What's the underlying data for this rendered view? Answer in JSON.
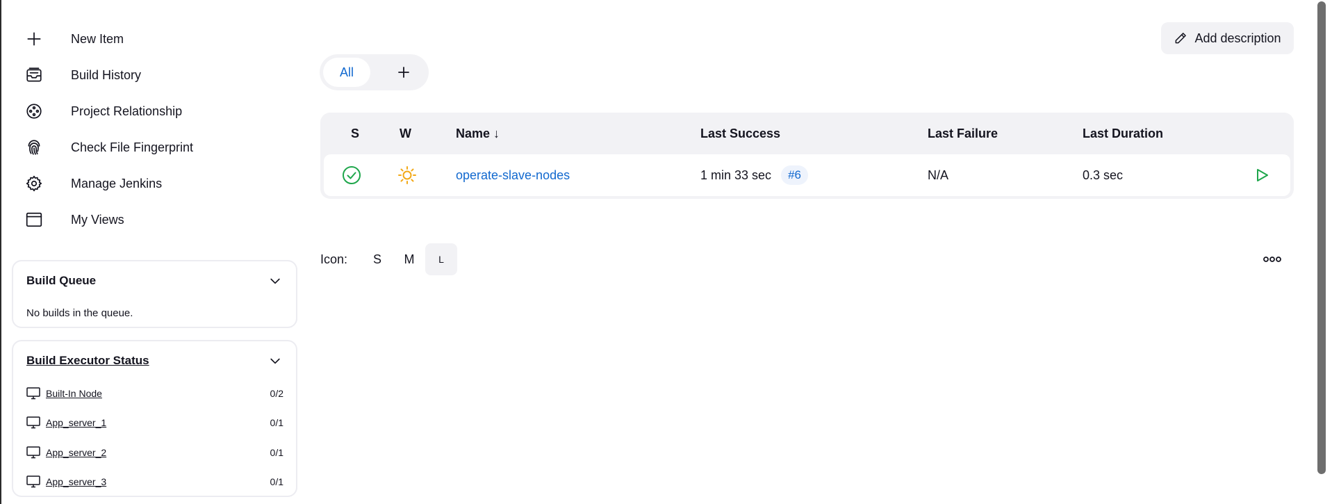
{
  "sidebar": {
    "items": [
      {
        "label": "New Item",
        "icon": "plus-icon"
      },
      {
        "label": "Build History",
        "icon": "inbox-icon"
      },
      {
        "label": "Project Relationship",
        "icon": "relationship-icon"
      },
      {
        "label": "Check File Fingerprint",
        "icon": "fingerprint-icon"
      },
      {
        "label": "Manage Jenkins",
        "icon": "gear-icon"
      },
      {
        "label": "My Views",
        "icon": "window-icon"
      }
    ]
  },
  "build_queue": {
    "title": "Build Queue",
    "empty_text": "No builds in the queue."
  },
  "executors": {
    "title": "Build Executor Status",
    "nodes": [
      {
        "name": "Built-In Node",
        "count": "0/2"
      },
      {
        "name": "App_server_1",
        "count": "0/1"
      },
      {
        "name": "App_server_2",
        "count": "0/1"
      },
      {
        "name": "App_server_3",
        "count": "0/1"
      }
    ]
  },
  "header": {
    "add_description": "Add description"
  },
  "tabs": {
    "active": "All",
    "add_icon": "plus-icon"
  },
  "table": {
    "headers": {
      "s": "S",
      "w": "W",
      "name": "Name ↓",
      "last_success": "Last Success",
      "last_failure": "Last Failure",
      "last_duration": "Last Duration"
    },
    "rows": [
      {
        "status": "success",
        "weather": "sunny",
        "name": "operate-slave-nodes",
        "last_success": "1 min 33 sec",
        "build": "#6",
        "last_failure": "N/A",
        "last_duration": "0.3 sec"
      }
    ]
  },
  "icon_size": {
    "label": "Icon:",
    "options": [
      "S",
      "M",
      "L"
    ],
    "selected": "L"
  },
  "colors": {
    "link": "#1269cf",
    "success": "#1ea64b",
    "weather": "#f2a917"
  }
}
